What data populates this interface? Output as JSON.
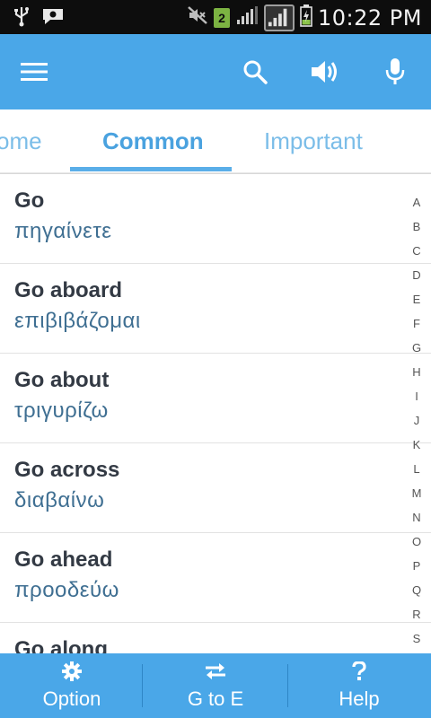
{
  "status_bar": {
    "sim_number": "2",
    "time": "10:22 PM"
  },
  "app_bar": {
    "icons": [
      "menu-icon",
      "search-icon",
      "speaker-icon",
      "microphone-icon"
    ]
  },
  "tabs": [
    {
      "label": "ome",
      "active": false
    },
    {
      "label": "Common",
      "active": true
    },
    {
      "label": "Important",
      "active": false
    }
  ],
  "list": [
    {
      "en": "Go",
      "gr": "πηγαίνετε"
    },
    {
      "en": "Go aboard",
      "gr": "επιβιβάζομαι"
    },
    {
      "en": "Go about",
      "gr": "τριγυρίζω"
    },
    {
      "en": "Go across",
      "gr": "διαβαίνω"
    },
    {
      "en": "Go ahead",
      "gr": "προοδεύω"
    },
    {
      "en": "Go along",
      "gr": ""
    }
  ],
  "alphabet": [
    "A",
    "B",
    "C",
    "D",
    "E",
    "F",
    "G",
    "H",
    "I",
    "J",
    "K",
    "L",
    "M",
    "N",
    "O",
    "P",
    "Q",
    "R",
    "S"
  ],
  "bottom_bar": {
    "option": "Option",
    "direction": "G to E",
    "help": "Help"
  },
  "colors": {
    "primary": "#4aa7e8",
    "tab_active": "#4aa2df",
    "greek_text": "#3f6f92"
  }
}
